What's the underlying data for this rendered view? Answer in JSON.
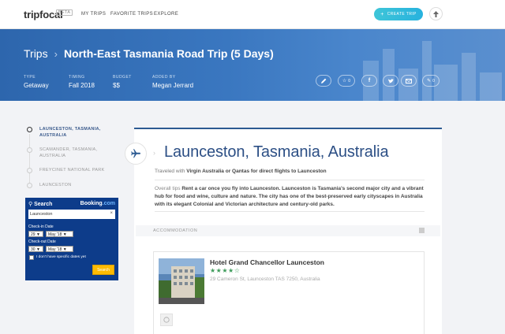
{
  "nav": {
    "logo": "tripfocal",
    "beta": "BETA",
    "links": [
      "MY TRIPS",
      "FAVORITE TRIPS",
      "EXPLORE"
    ],
    "create_trip": "CREATE TRIP"
  },
  "banner": {
    "breadcrumb_root": "Trips",
    "trip_title": "North-East Tasmania Road Trip (5 Days)",
    "meta": [
      {
        "key": "TYPE",
        "value": "Getaway"
      },
      {
        "key": "TIMING",
        "value": "Fall 2018"
      },
      {
        "key": "BUDGET",
        "value": "$$"
      },
      {
        "key": "ADDED BY",
        "value": "Megan Jerrard"
      }
    ],
    "like_count": "0",
    "comment_count": "0"
  },
  "steps": [
    {
      "label": "LAUNCESTON, TASMANIA, AUSTRALIA",
      "active": true
    },
    {
      "label": "SCAMANDER, TASMANIA, AUSTRALIA",
      "active": false
    },
    {
      "label": "FREYCINET NATIONAL PARK",
      "active": false
    },
    {
      "label": "LAUNCESTON",
      "active": false
    }
  ],
  "booking": {
    "heading": "Search",
    "brand": "Booking",
    "brand_suffix": ".com",
    "destination": "Launceston",
    "checkin_label": "Check-in Date",
    "checkin_day": "29",
    "checkin_month": "May '18",
    "checkout_label": "Check-out Date",
    "checkout_day": "30",
    "checkout_month": "May '18",
    "no_dates_label": "I don't have specific dates yet",
    "search_button": "Search"
  },
  "destination": {
    "title": "Launceston, Tasmania, Australia",
    "travel_prefix": "Traveled with",
    "travel_text": "Virgin Australia or Qantas for direct flights to Launceston",
    "overview_prefix": "Overall tips",
    "overview_text": "Rent a car once you fly into Launceston. Launceston is Tasmania's second major city and a vibrant hub for food and wine, culture and nature. The city has one of the best-preserved early cityscapes in Australia with its elegant Colonial and Victorian architecture and century-old parks.",
    "section_label": "ACCOMMODATION"
  },
  "hotel": {
    "name": "Hotel Grand Chancellor Launceston",
    "rating": 4,
    "max_rating": 5,
    "address": "29 Cameron St, Launceston TAS 7250, Australia"
  },
  "colors": {
    "banner": "#3a77c0",
    "accent": "#2c4f85",
    "create_button": "#3ec5d8",
    "booking_bg": "#0d3c8a",
    "booking_button": "#febb02",
    "stars": "#3d9b5a"
  }
}
